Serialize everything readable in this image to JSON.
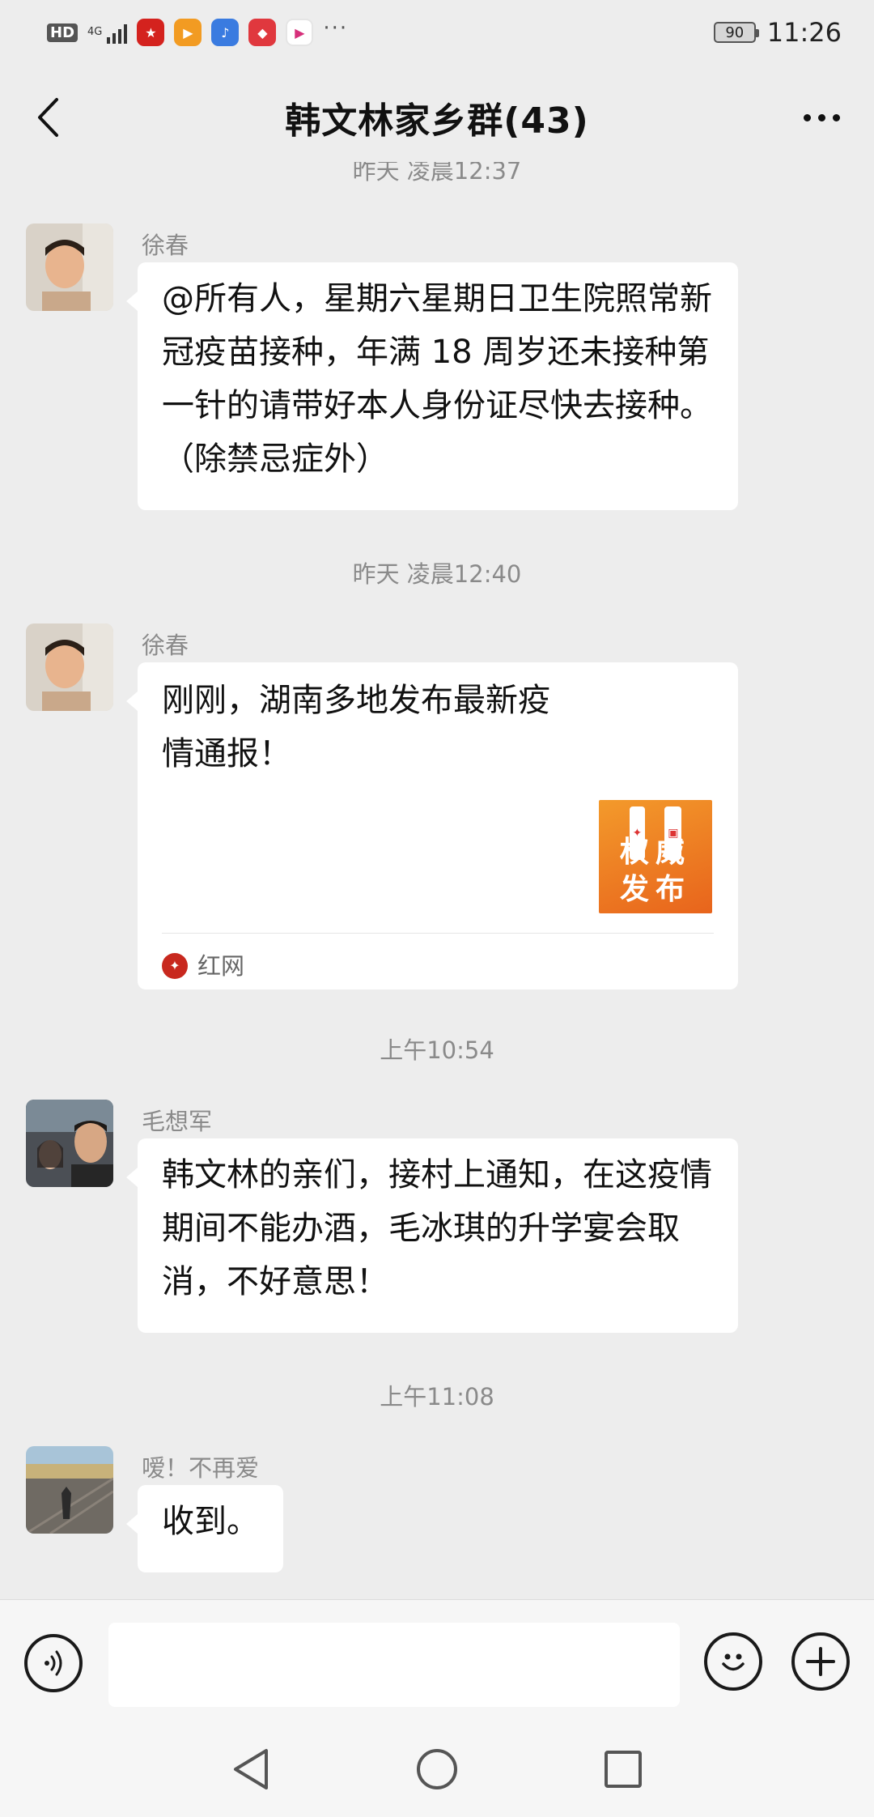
{
  "status_bar": {
    "hd": "HD",
    "network": "4G",
    "battery": "90",
    "time": "11:26",
    "more": "···"
  },
  "header": {
    "title": "韩文林家乡群(43)"
  },
  "chat": {
    "partial_timestamp": "昨天 凌晨12:37",
    "messages": [
      {
        "sender": "徐春",
        "text": "@所有人，星期六星期日卫生院照常新冠疫苗接种，年满 18 周岁还未接种第一针的请带好本人身份证尽快去接种。（除禁忌症外）"
      },
      {
        "timestamp": "昨天 凌晨12:40",
        "sender": "徐春",
        "card": {
          "title": "刚刚，湖南多地发布最新疫情通报！",
          "thumb_text_line1": "权威",
          "thumb_text_line2": "发布",
          "source": "红网"
        }
      },
      {
        "timestamp": "上午10:54",
        "sender": "毛想军",
        "text": "韩文林的亲们，接村上通知，在这疫情期间不能办酒，毛冰琪的升学宴会取消，不好意思！"
      },
      {
        "timestamp": "上午11:08",
        "sender": "嗳！不再爱",
        "text": "收到。"
      }
    ]
  },
  "input_bar": {
    "value": ""
  },
  "colors": {
    "background": "#ededed",
    "bubble": "#ffffff",
    "card_thumb": "#f08a24"
  }
}
